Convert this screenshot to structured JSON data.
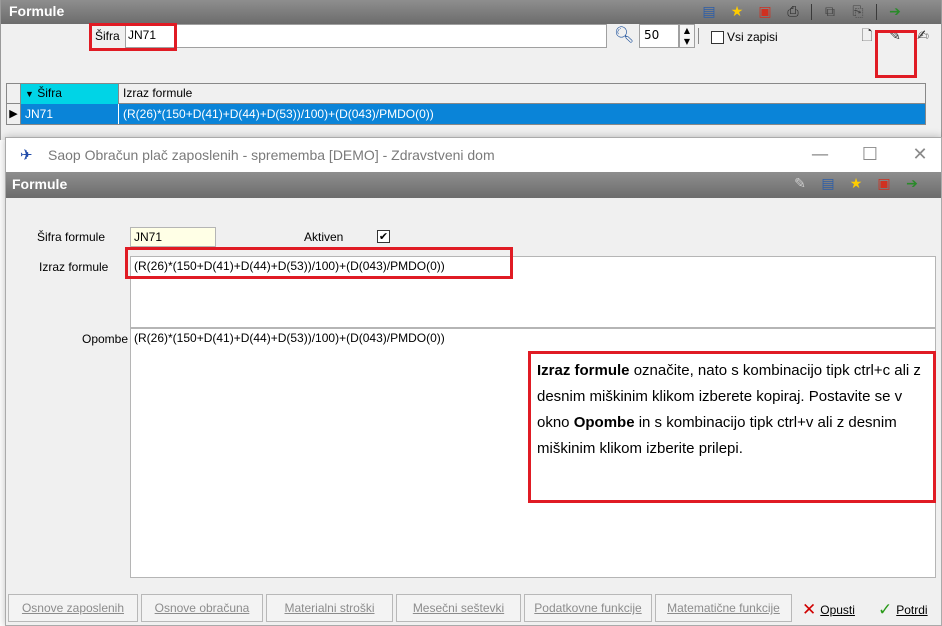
{
  "list_window": {
    "title": "Formule",
    "filter": {
      "code_label": "Šifra",
      "code_value": "JN71",
      "limit_value": "50",
      "all_records_label": "Vsi zapisi",
      "all_records_checked": false
    },
    "grid": {
      "columns": [
        "Šifra",
        "Izraz formule"
      ],
      "rows": [
        {
          "sifra": "JN71",
          "izraz": "(R(26)*(150+D(41)+D(44)+D(53))/100)+(D(043)/PMDO(0))"
        }
      ]
    }
  },
  "dialog": {
    "window_title": "Saop Obračun plač zaposlenih - sprememba [DEMO] - Zdravstveni dom",
    "section_title": "Formule",
    "fields": {
      "code_label": "Šifra formule",
      "code_value": "JN71",
      "active_label": "Aktiven",
      "active_checked": true,
      "expression_label": "Izraz formule",
      "expression_value": "(R(26)*(150+D(41)+D(44)+D(53))/100)+(D(043)/PMDO(0))",
      "notes_label": "Opombe",
      "notes_value": "(R(26)*(150+D(41)+D(44)+D(53))/100)+(D(043)/PMDO(0))"
    },
    "tip": {
      "t1_bold": "Izraz formule",
      "t2": " označite, nato s kombinacijo tipk ctrl+c ali z desnim miškinim klikom izberete kopiraj. Postavite se v okno ",
      "t3_bold": "Opombe",
      "t4": " in s kombinacijo tipk ctrl+v ali z desnim miškinim klikom izberite prilepi."
    },
    "function_buttons": [
      "Osnove zaposlenih",
      "Osnove obračuna",
      "Materialni stroški",
      "Mesečni seštevki",
      "Podatkovne funkcije",
      "Matematične funkcije"
    ],
    "cancel_label": "Opusti",
    "confirm_label": "Potrdi"
  },
  "colors": {
    "titlebar_gray": "#7d7d7d",
    "selected_row": "#0a84d8",
    "sort_header": "#00d4e6",
    "highlight_red": "#e01b24",
    "cancel_red": "#d00000",
    "confirm_green": "#2a9a1a"
  },
  "icons": {
    "toolbar_top": [
      "grid-icon",
      "star-icon",
      "excel-export-icon",
      "print-icon",
      "copy-icon",
      "paste-icon",
      "exit-icon"
    ],
    "toolbar_filter": [
      "new-record-icon",
      "edit-record-icon",
      "multi-edit-icon"
    ],
    "dialog_toolbar": [
      "edit-icon",
      "grid-icon",
      "star-icon",
      "excel-export-icon",
      "exit-icon"
    ]
  }
}
